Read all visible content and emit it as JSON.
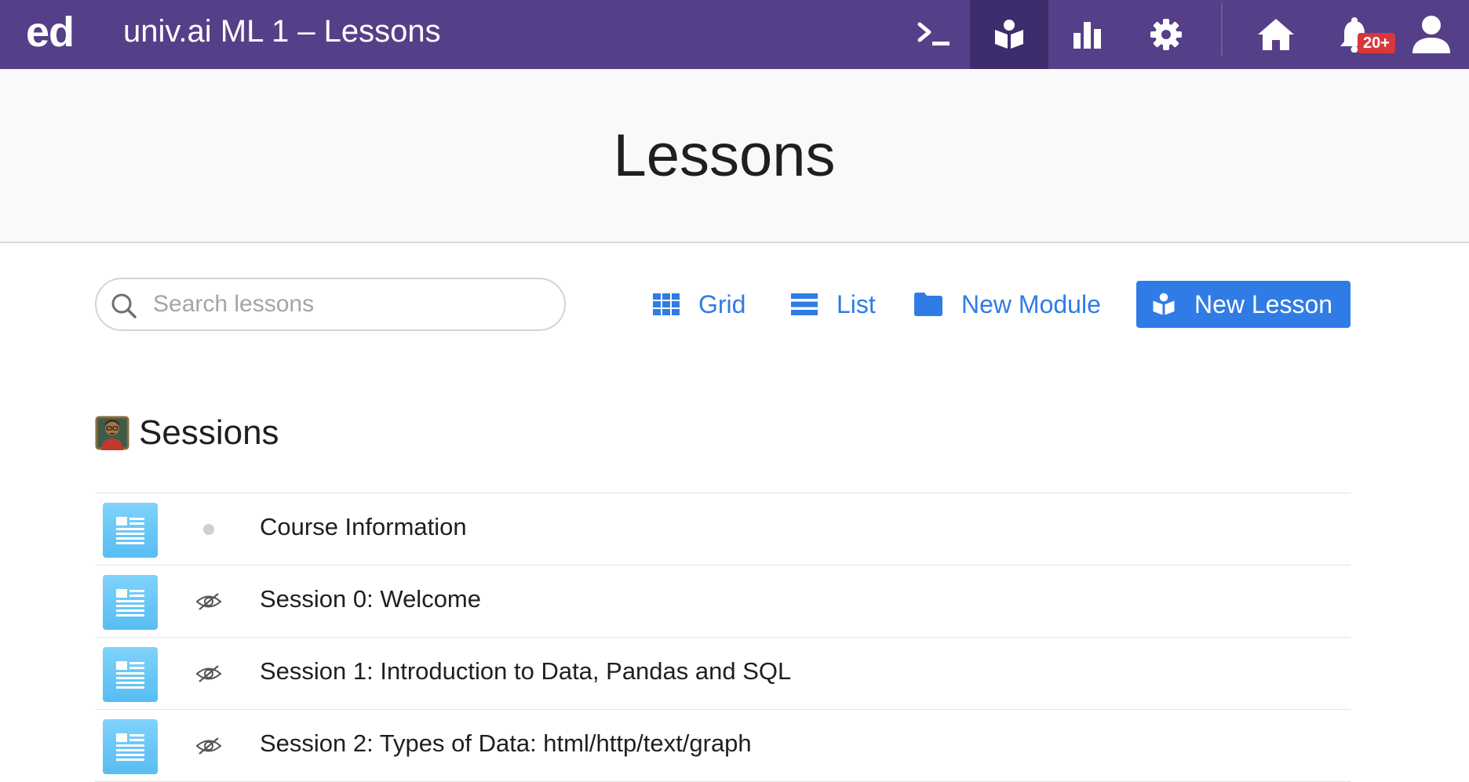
{
  "topbar": {
    "brand": "ed",
    "title": "univ.ai ML 1 – Lessons",
    "icons": [
      "terminal-icon",
      "lessons-icon",
      "analytics-icon",
      "settings-icon",
      "home-icon",
      "bell-icon",
      "user-icon"
    ],
    "notifications_badge": "20+",
    "active_item": "lessons",
    "bg_color": "#553f88",
    "active_bg_color": "#3e2d6c",
    "badge_color": "#d9363e"
  },
  "header": {
    "title": "Lessons"
  },
  "toolbar": {
    "search_placeholder": "Search lessons",
    "search_value": "",
    "grid_label": "Grid",
    "list_label": "List",
    "new_module_label": "New Module",
    "new_lesson_label": "New Lesson",
    "accent_color": "#2f7ce6"
  },
  "module": {
    "emoji": "teacher-emoji",
    "title": "Sessions",
    "lessons": [
      {
        "title": "Course Information",
        "status": "dot"
      },
      {
        "title": "Session 0: Welcome",
        "status": "hidden"
      },
      {
        "title": "Session 1: Introduction to Data, Pandas and SQL",
        "status": "hidden"
      },
      {
        "title": "Session 2: Types of Data: html/http/text/graph",
        "status": "hidden"
      }
    ]
  }
}
